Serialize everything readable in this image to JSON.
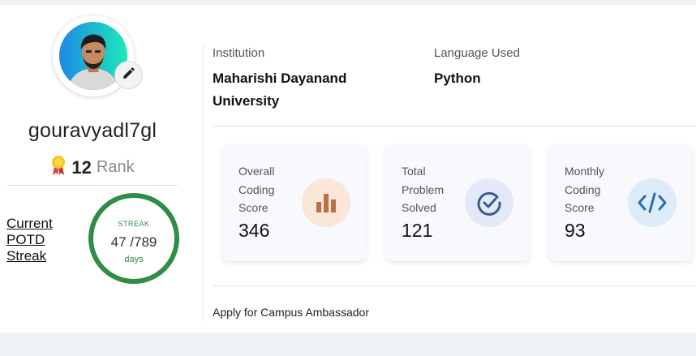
{
  "profile": {
    "username": "gouravyadl7gl",
    "rank_value": "12",
    "rank_label": "Rank",
    "potd_label_line1": "Current",
    "potd_label_line2": "POTD",
    "potd_label_line3": "Streak",
    "streak": {
      "title": "STREAK",
      "current": "47",
      "total": "/789",
      "unit": "days"
    }
  },
  "info": {
    "institution_label": "Institution",
    "institution_line1": "Maharishi Dayanand",
    "institution_line2": "University",
    "language_label": "Language Used",
    "language_value": "Python"
  },
  "stats": [
    {
      "label_line1": "Overall",
      "label_line2": "Coding",
      "label_line3": "Score",
      "value": "346",
      "icon": "bar-chart-icon"
    },
    {
      "label_line1": "Total",
      "label_line2": "Problem",
      "label_line3": "Solved",
      "value": "121",
      "icon": "check-circle-icon"
    },
    {
      "label_line1": "Monthly",
      "label_line2": "Coding",
      "label_line3": "Score",
      "value": "93",
      "icon": "code-icon"
    }
  ],
  "links": {
    "campus_ambassador": "Apply for Campus Ambassador"
  },
  "colors": {
    "streak_green": "#2f8d46",
    "score_icon_bg": "#fbe6da",
    "solved_icon_bg": "#e3e9f7",
    "monthly_icon_bg": "#dcecf8"
  }
}
